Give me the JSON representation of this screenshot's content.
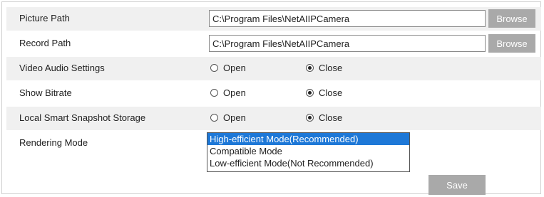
{
  "settings": {
    "picture_path": {
      "label": "Picture Path",
      "value": "C:\\Program Files\\NetAIIPCamera",
      "button": "Browse"
    },
    "record_path": {
      "label": "Record Path",
      "value": "C:\\Program Files\\NetAIIPCamera",
      "button": "Browse"
    },
    "video_audio": {
      "label": "Video Audio Settings",
      "options": [
        "Open",
        "Close"
      ],
      "selected": "Close"
    },
    "show_bitrate": {
      "label": "Show Bitrate",
      "options": [
        "Open",
        "Close"
      ],
      "selected": "Close"
    },
    "local_snapshot": {
      "label": "Local Smart Snapshot Storage",
      "options": [
        "Open",
        "Close"
      ],
      "selected": "Close"
    },
    "rendering_mode": {
      "label": "Rendering Mode",
      "options": [
        "High-efficient Mode(Recommended)",
        "Compatible Mode",
        "Low-efficient Mode(Not Recommended)"
      ],
      "selected": "High-efficient Mode(Recommended)"
    }
  },
  "save_button": "Save",
  "colors": {
    "row_shade": "#f0f0f0",
    "button_bg": "#a9a9a9",
    "selection": "#1e78d7"
  }
}
